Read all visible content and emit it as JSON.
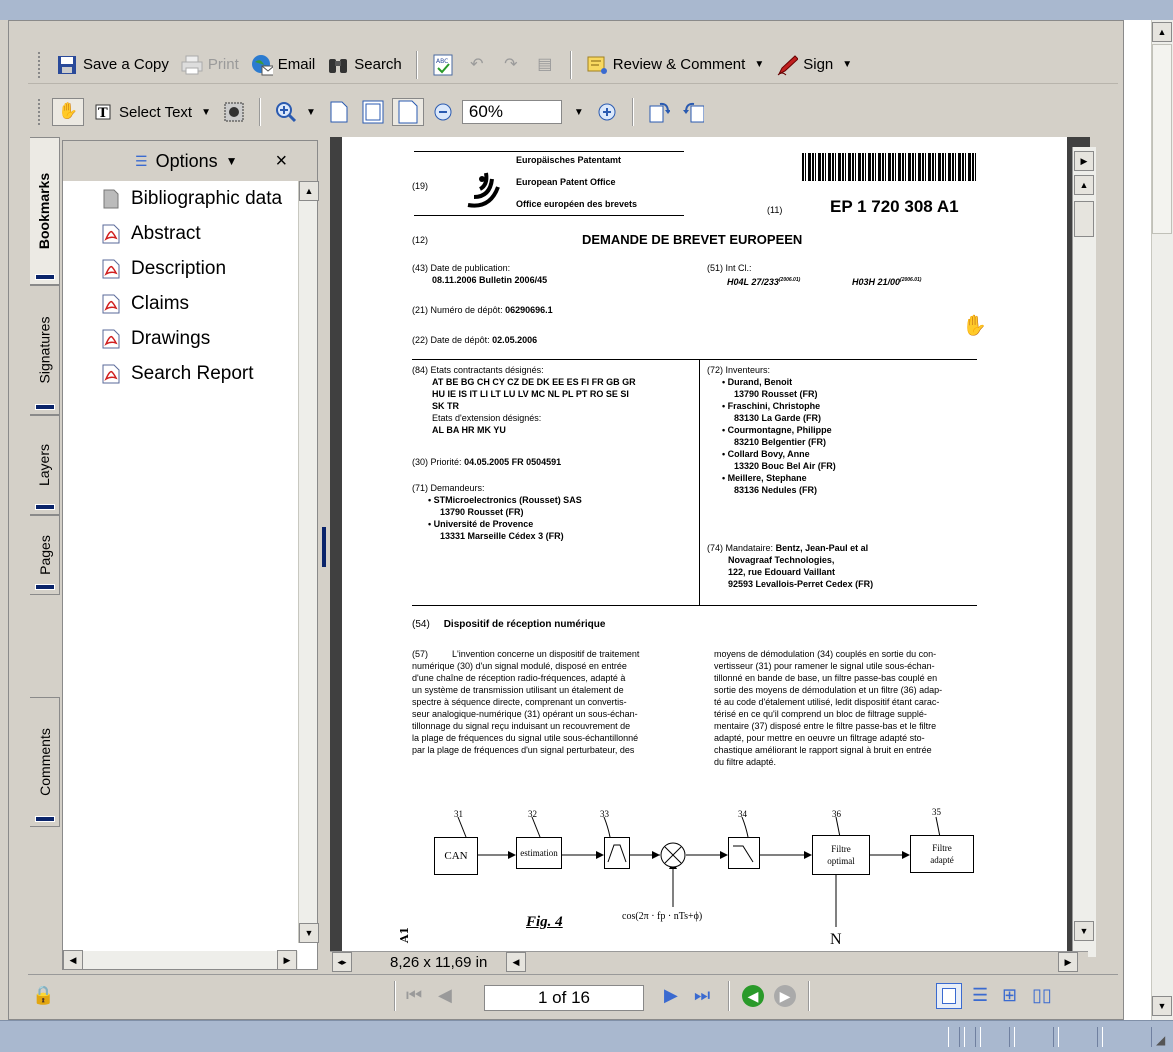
{
  "toolbar1": {
    "save_copy": "Save a Copy",
    "print": "Print",
    "email": "Email",
    "search": "Search",
    "review_comment": "Review & Comment",
    "sign": "Sign"
  },
  "toolbar2": {
    "select_text": "Select Text",
    "zoom_value": "60%"
  },
  "side_tabs": [
    "Bookmarks",
    "Signatures",
    "Layers",
    "Pages",
    "Comments"
  ],
  "panel": {
    "options_label": "Options",
    "close_glyph": "×",
    "bookmarks": [
      {
        "label": "Bibliographic data",
        "icon": "page-icon"
      },
      {
        "label": "Abstract",
        "icon": "pdf-icon"
      },
      {
        "label": "Description",
        "icon": "pdf-icon"
      },
      {
        "label": "Claims",
        "icon": "pdf-icon"
      },
      {
        "label": "Drawings",
        "icon": "pdf-icon"
      },
      {
        "label": "Search Report",
        "icon": "pdf-icon"
      }
    ]
  },
  "page_size": "8,26 x 11,69 in",
  "nav": {
    "page_display": "1 of 16"
  },
  "document": {
    "code19": "(19)",
    "office_de": "Europäisches Patentamt",
    "office_en": "European Patent Office",
    "office_fr": "Office européen des brevets",
    "code11": "(11)",
    "pub_number": "EP 1 720 308 A1",
    "code12": "(12)",
    "doc_type": "DEMANDE DE BREVET EUROPEEN",
    "code43": "(43)",
    "pub_date_label": "Date de publication:",
    "pub_date": "08.11.2006  Bulletin 2006/45",
    "code51": "(51)",
    "int_cl_label": "Int Cl.:",
    "int_cl_1": "H04L 27/233",
    "int_cl_1_sup": "(2006.01)",
    "int_cl_2": "H03H 21/00",
    "int_cl_2_sup": "(2006.01)",
    "code21": "(21)",
    "app_num_label": "Numéro de dépôt:",
    "app_num": "06290696.1",
    "code22": "(22)",
    "filing_date_label": "Date de dépôt:",
    "filing_date": "02.05.2006",
    "code84": "(84)",
    "states_label": "Etats contractants désignés:",
    "states_1": "AT BE BG CH CY CZ DE DK EE ES FI FR GB GR",
    "states_2": "HU IE IS IT LI LT LU LV MC NL PL PT RO SE SI",
    "states_3": "SK TR",
    "ext_label": "Etats d'extension désignés:",
    "ext_states": "AL BA HR MK YU",
    "code30": "(30)",
    "priority_label": "Priorité:",
    "priority": "04.05.2005  FR 0504591",
    "code71": "(71)",
    "applicants_label": "Demandeurs:",
    "applicant_1": "STMicroelectronics (Rousset) SAS",
    "applicant_1_addr": "13790 Rousset (FR)",
    "applicant_2": "Université de Provence",
    "applicant_2_addr": "13331 Marseille Cédex 3 (FR)",
    "code72": "(72)",
    "inventors_label": "Inventeurs:",
    "inventors": [
      {
        "name": "Durand, Benoit",
        "addr": "13790 Rousset (FR)"
      },
      {
        "name": "Fraschini, Christophe",
        "addr": "83130 La Garde (FR)"
      },
      {
        "name": "Courmontagne, Philippe",
        "addr": "83210 Belgentier (FR)"
      },
      {
        "name": "Collard Bovy, Anne",
        "addr": "13320 Bouc Bel Air (FR)"
      },
      {
        "name": "Meillere, Stephane",
        "addr": "83136 Nedules (FR)"
      }
    ],
    "code74": "(74)",
    "agent_label": "Mandataire:",
    "agent_1": "Bentz, Jean-Paul et al",
    "agent_2": "Novagraaf Technologies,",
    "agent_3": "122, rue Edouard Vaillant",
    "agent_4": "92593 Levallois-Perret Cedex (FR)",
    "code54": "(54)",
    "title": "Dispositif de réception numérique",
    "code57": "(57)",
    "abstract_left": [
      "L'invention concerne un dispositif de traitement",
      "numérique (30) d'un signal modulé, disposé en entrée",
      "d'une chaîne de réception radio-fréquences, adapté à",
      "un système de transmission utilisant un étalement de",
      "spectre à séquence directe, comprenant un convertis-",
      "seur analogique-numérique (31) opérant un sous-échan-",
      "tillonnage du signal reçu induisant un recouvrement de",
      "la plage de fréquences du signal utile sous-échantillonné",
      "par la plage de fréquences d'un signal perturbateur, des"
    ],
    "abstract_right": [
      "moyens de démodulation (34) couplés en sortie du con-",
      "vertisseur (31) pour ramener le signal utile sous-échan-",
      "tillonné en bande de base, un filtre passe-bas couplé en",
      "sortie des moyens de démodulation et un filtre (36) adap-",
      "té au code d'étalement utilisé, ledit dispositif étant carac-",
      "térisé en ce qu'il comprend un bloc de filtrage supplé-",
      "mentaire (37) disposé entre le filtre passe-bas et le filtre",
      "adapté, pour mettre en oeuvre un filtrage adapté sto-",
      "chastique améliorant le rapport signal à bruit en entrée",
      "du filtre adapté."
    ],
    "diagram": {
      "n31": "31",
      "n32": "32",
      "n33": "33",
      "n34": "34",
      "n36": "36",
      "n35": "35",
      "can": "CAN",
      "estimation": "estimation",
      "filtre_optimal_1": "Filtre",
      "filtre_optimal_2": "optimal",
      "filtre_adapte_1": "Filtre",
      "filtre_adapte_2": "adapté",
      "cos_label": "cos(2π · fp · nTs+ϕ)",
      "n_label": "N",
      "fig_label": "Fig. 4",
      "side_text": "A1"
    }
  }
}
